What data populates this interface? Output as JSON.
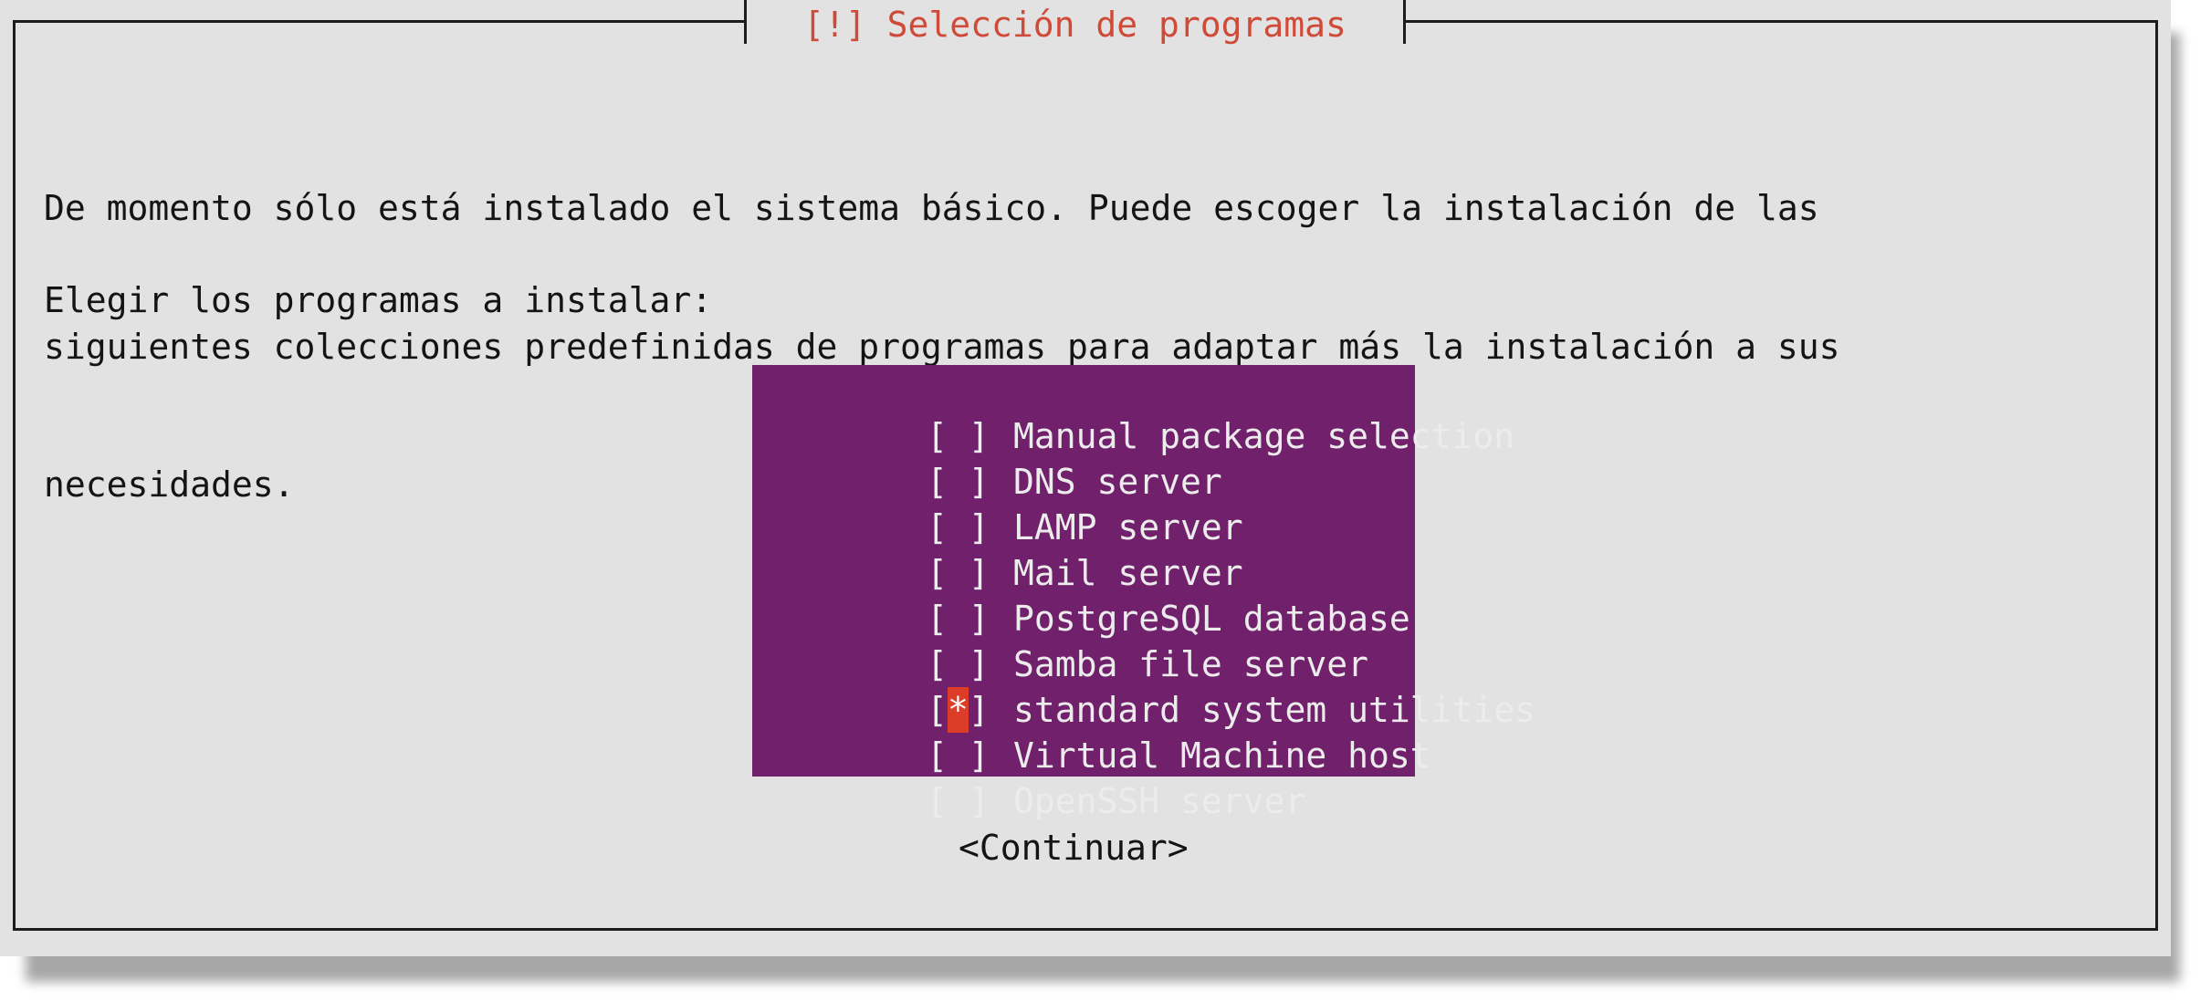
{
  "dialog": {
    "title": "[!] Selección de programas",
    "body_lines": [
      "De momento sólo está instalado el sistema básico. Puede escoger la instalación de las",
      "siguientes colecciones predefinidas de programas para adaptar más la instalación a sus",
      "necesidades."
    ],
    "prompt": "Elegir los programas a instalar:",
    "continue_label": "<Continuar>"
  },
  "packages": [
    {
      "label": "Manual package selection",
      "mark": " ",
      "checked": false
    },
    {
      "label": "DNS server",
      "mark": " ",
      "checked": false
    },
    {
      "label": "LAMP server",
      "mark": " ",
      "checked": false
    },
    {
      "label": "Mail server",
      "mark": " ",
      "checked": false
    },
    {
      "label": "PostgreSQL database",
      "mark": " ",
      "checked": false
    },
    {
      "label": "Samba file server",
      "mark": " ",
      "checked": false
    },
    {
      "label": "standard system utilities",
      "mark": "*",
      "checked": true
    },
    {
      "label": "Virtual Machine host",
      "mark": " ",
      "checked": false
    },
    {
      "label": "OpenSSH server",
      "mark": " ",
      "checked": false
    }
  ],
  "colors": {
    "dialog_background": "#e2e2e2",
    "title": "#d04a38",
    "list_background": "#71206b",
    "list_text": "#ececec",
    "checked_highlight": "#dd3c28"
  }
}
